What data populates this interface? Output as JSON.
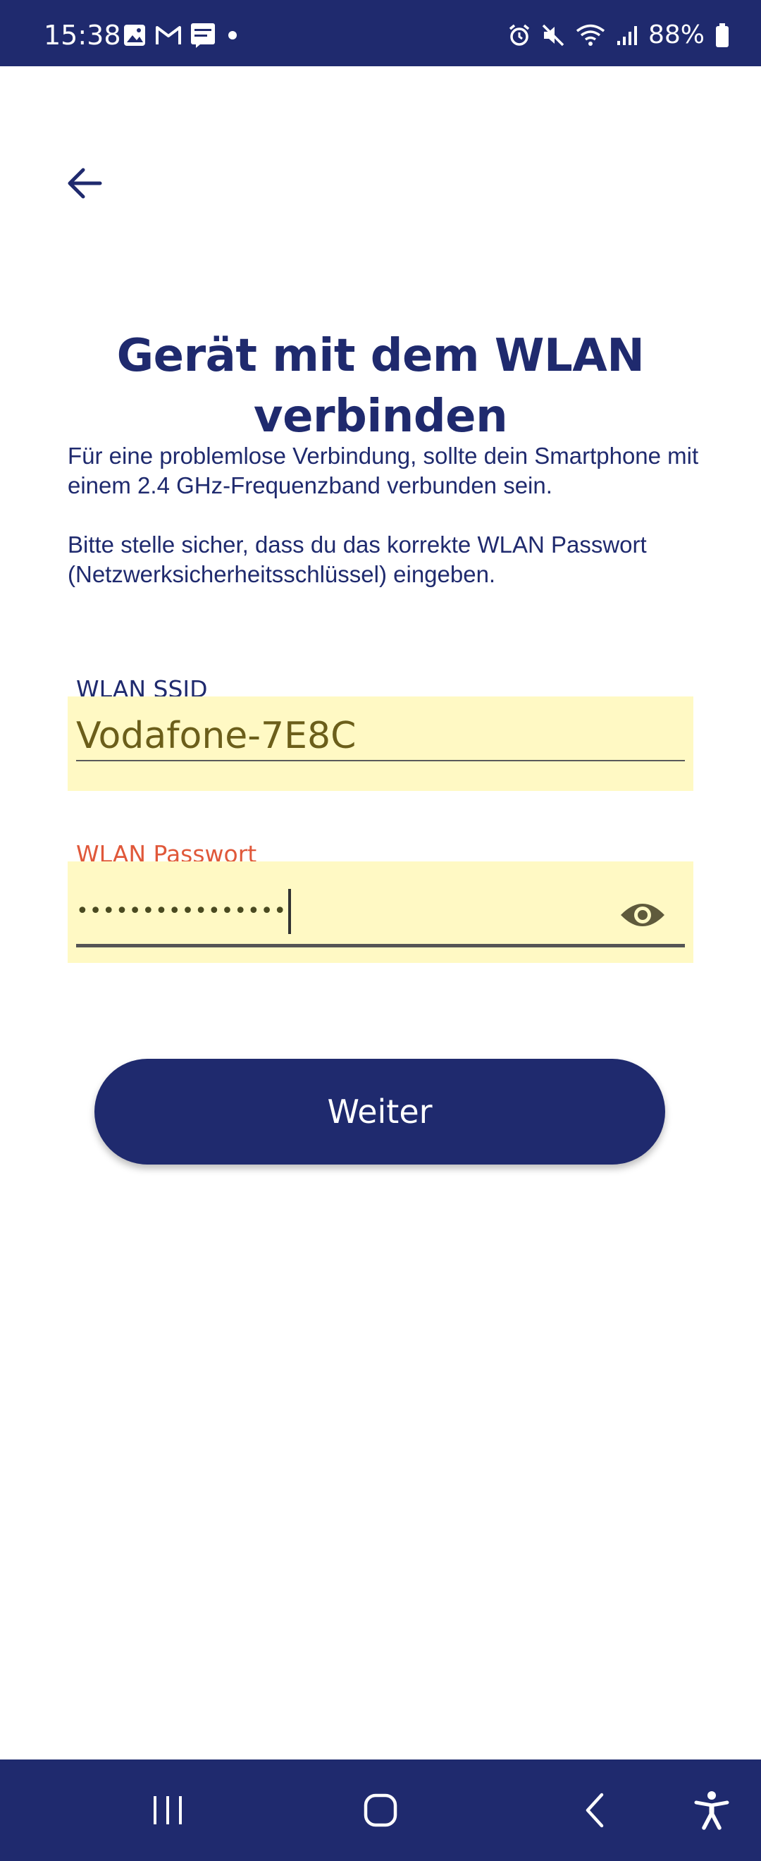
{
  "status_bar": {
    "time": "15:38",
    "battery": "88%",
    "left_icons": [
      "gallery-icon",
      "gmail-icon",
      "consorsbank-icon",
      "dot-icon"
    ],
    "right_icons": [
      "alarm-icon",
      "mute-icon",
      "wifi-icon",
      "signal-icon",
      "battery-icon"
    ]
  },
  "header": {
    "back_icon": "arrow-left-icon"
  },
  "title": "Gerät mit dem WLAN verbinden",
  "info": {
    "paragraph1": "Für eine problemlose Verbindung, sollte dein Smartphone mit einem 2.4 GHz-Frequenzband verbunden sein.",
    "paragraph2": "Bitte stelle sicher, dass du das korrekte WLAN Passwort (Netzwerksicherheitsschlüssel) eingeben."
  },
  "ssid_field": {
    "label": "WLAN SSID",
    "value": "Vodafone-7E8C"
  },
  "password_field": {
    "label": "WLAN Passwort",
    "masked_value": "••••••••••••••••",
    "toggle_icon": "eye-icon"
  },
  "primary_button": {
    "label": "Weiter"
  },
  "nav_bar": {
    "icons": [
      "recents-icon",
      "home-icon",
      "back-icon",
      "accessibility-icon"
    ]
  },
  "colors": {
    "primary": "#1f2a6e",
    "field_background": "#fff9c4",
    "error_label": "#e0583a"
  }
}
